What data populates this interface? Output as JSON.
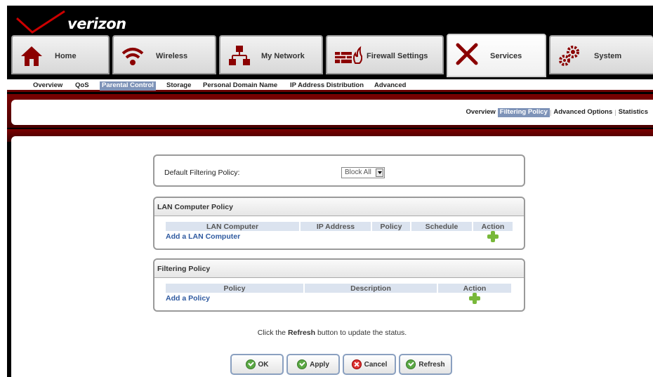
{
  "brand": {
    "logo_text": "verizon"
  },
  "main_tabs": [
    {
      "label": "Home",
      "icon": "home-icon"
    },
    {
      "label": "Wireless",
      "icon": "wireless-icon"
    },
    {
      "label": "My Network",
      "icon": "network-icon"
    },
    {
      "label": "Firewall Settings",
      "icon": "firewall-icon"
    },
    {
      "label": "Services",
      "icon": "services-icon",
      "active": true
    },
    {
      "label": "System",
      "icon": "system-gears-icon"
    }
  ],
  "sub_nav": [
    {
      "label": "Overview"
    },
    {
      "label": "QoS"
    },
    {
      "label": "Parental Control",
      "active": true
    },
    {
      "label": "Storage"
    },
    {
      "label": "Personal Domain Name"
    },
    {
      "label": "IP Address Distribution"
    },
    {
      "label": "Advanced"
    }
  ],
  "page_nav": [
    {
      "label": "Overview"
    },
    {
      "label": "Filtering Policy",
      "active": true
    },
    {
      "label": "Advanced Options"
    },
    {
      "label": "Statistics"
    }
  ],
  "default_policy": {
    "label": "Default Filtering Policy:",
    "selected": "Block All"
  },
  "lan_policy": {
    "title": "LAN Computer Policy",
    "columns": [
      "LAN Computer",
      "IP Address",
      "Policy",
      "Schedule",
      "Action"
    ],
    "add_label": "Add a LAN Computer"
  },
  "filtering_policy": {
    "title": "Filtering Policy",
    "columns": [
      "Policy",
      "Description",
      "Action"
    ],
    "add_label": "Add a Policy"
  },
  "status": {
    "prefix": "Click the ",
    "bold": "Refresh",
    "suffix": " button to update the status."
  },
  "buttons": {
    "ok": "OK",
    "apply": "Apply",
    "cancel": "Cancel",
    "refresh": "Refresh"
  },
  "colors": {
    "brand_red": "#6b0000",
    "active_highlight": "#7e93b8",
    "link_blue": "#2f5aa0",
    "add_green": "#78b83a"
  }
}
